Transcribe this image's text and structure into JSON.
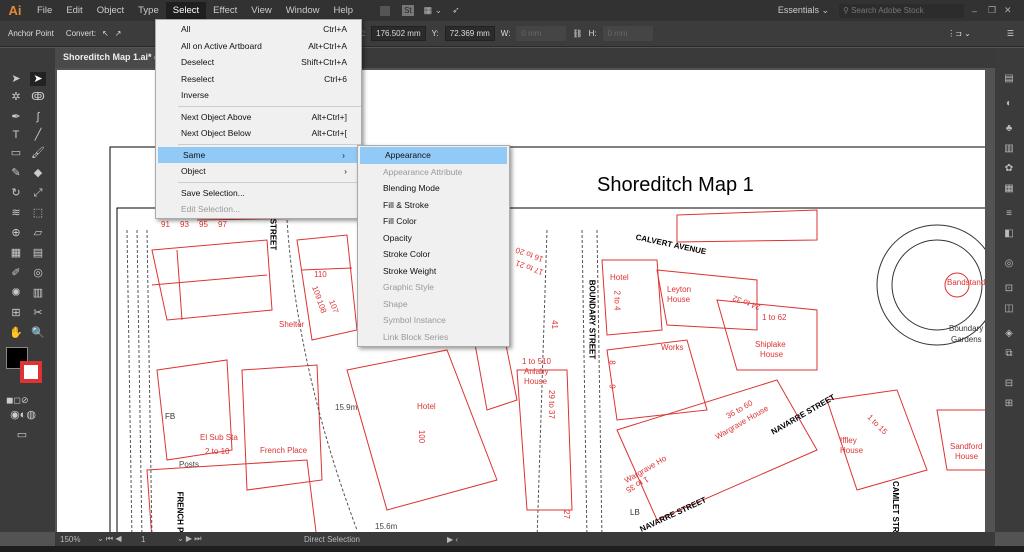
{
  "app": {
    "logo": "Ai"
  },
  "menubar": [
    "File",
    "Edit",
    "Object",
    "Type",
    "Select",
    "Effect",
    "View",
    "Window",
    "Help"
  ],
  "menubar_right": {
    "st": "St",
    "workspace": "Essentials",
    "search_placeholder": "Search Adobe Stock"
  },
  "control": {
    "anchor_point": "Anchor Point",
    "convert": "Convert:",
    "x_label": "X:",
    "x_value": "176.502 mm",
    "y_label": "Y:",
    "y_value": "72.369 mm",
    "w_label": "W:",
    "w_value": "0 mm",
    "h_label": "H:",
    "h_value": "0 mm"
  },
  "document_tab": "Shoreditch Map 1.ai* @",
  "select_menu": [
    {
      "label": "All",
      "shortcut": "Ctrl+A"
    },
    {
      "label": "All on Active Artboard",
      "shortcut": "Alt+Ctrl+A"
    },
    {
      "label": "Deselect",
      "shortcut": "Shift+Ctrl+A"
    },
    {
      "label": "Reselect",
      "shortcut": "Ctrl+6"
    },
    {
      "label": "Inverse",
      "shortcut": ""
    },
    {
      "label": "Next Object Above",
      "shortcut": "Alt+Ctrl+]"
    },
    {
      "label": "Next Object Below",
      "shortcut": "Alt+Ctrl+["
    },
    {
      "label": "Same",
      "shortcut": "›"
    },
    {
      "label": "Object",
      "shortcut": "›"
    },
    {
      "label": "Save Selection...",
      "shortcut": ""
    },
    {
      "label": "Edit Selection...",
      "shortcut": ""
    }
  ],
  "same_submenu": [
    "Appearance",
    "Appearance Attribute",
    "Blending Mode",
    "Fill & Stroke",
    "Fill Color",
    "Opacity",
    "Stroke Color",
    "Stroke Weight",
    "Graphic Style",
    "Shape",
    "Symbol Instance",
    "Link Block Series"
  ],
  "map": {
    "title": "Shoreditch Map 1",
    "labels": [
      "Shelter",
      "Hotel",
      "1 to 510",
      "Anlaby",
      "House",
      "29 to 37",
      "Hotel",
      "2 to 4",
      "Leyton",
      "House",
      "24 to 32",
      "1 to 62",
      "Works",
      "Shiplake",
      "House",
      "36 to 60",
      "Wargrave House",
      "Wargrave Ho",
      "1 to 35",
      "1 to 15",
      "Iffley",
      "House",
      "Bandstand",
      "Boundary",
      "Gardens",
      "Sandford",
      "House",
      "El Sub Sta",
      "2 to 10",
      "French Place",
      "Posts",
      "15.9m",
      "15.6m",
      "100",
      "110",
      "107",
      "108",
      "109",
      "16 to 20",
      "17 to 21",
      "41",
      "27",
      "FB",
      "LB",
      "91",
      "93",
      "95",
      "97",
      "8",
      "9"
    ],
    "streets": [
      "CALVERT AVENUE",
      "BOUNDARY STREET",
      "NAVARRE STREET",
      "NAVARRE STREET",
      "FRENCH PL",
      "CAMLET STREET",
      "STREET"
    ]
  },
  "status": {
    "zoom": "150%",
    "page": "1",
    "tool": "Direct Selection"
  }
}
